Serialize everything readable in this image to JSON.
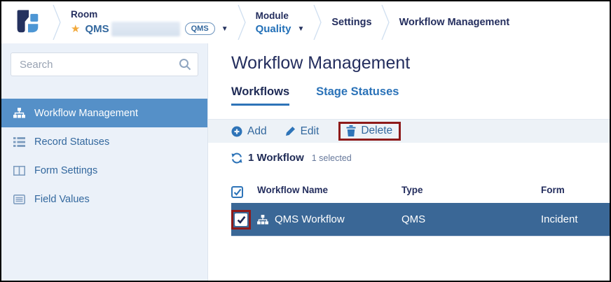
{
  "header": {
    "room": {
      "label": "Room",
      "name": "QMS",
      "badge": "QMS"
    },
    "module": {
      "label": "Module",
      "value": "Quality"
    },
    "settings": "Settings",
    "workflow_management": "Workflow Management"
  },
  "sidebar": {
    "search_placeholder": "Search",
    "items": [
      {
        "label": "Workflow Management",
        "icon": "sitemap-icon",
        "selected": true
      },
      {
        "label": "Record Statuses",
        "icon": "list-icon",
        "selected": false
      },
      {
        "label": "Form Settings",
        "icon": "columns-icon",
        "selected": false
      },
      {
        "label": "Field Values",
        "icon": "list-alt-icon",
        "selected": false
      }
    ]
  },
  "main": {
    "title": "Workflow Management",
    "tabs": [
      {
        "label": "Workflows",
        "active": true
      },
      {
        "label": "Stage Statuses",
        "active": false
      }
    ],
    "toolbar": {
      "add": "Add",
      "edit": "Edit",
      "delete": "Delete"
    },
    "summary": {
      "count_label": "1 Workflow",
      "selected_label": "1 selected"
    },
    "table": {
      "columns": [
        "Workflow Name",
        "Type",
        "Form"
      ],
      "rows": [
        {
          "name": "QMS Workflow",
          "type": "QMS",
          "form": "Incident",
          "selected": true,
          "checked": true
        }
      ]
    }
  },
  "annotations": {
    "highlight_color": "#8e1a1a",
    "highlighted_elements": [
      "delete-button",
      "row-checkbox"
    ]
  },
  "colors": {
    "navy_text": "#242e5e",
    "steel_blue_text": "#33689e",
    "accent_blue": "#2e74b8",
    "sidebar_bg": "#ebf1f9",
    "sidebar_selected_bg": "#5590c8",
    "row_selected_bg": "#3a6796",
    "toolbar_bg": "#edf2f7",
    "star_gold": "#f2a93b"
  }
}
